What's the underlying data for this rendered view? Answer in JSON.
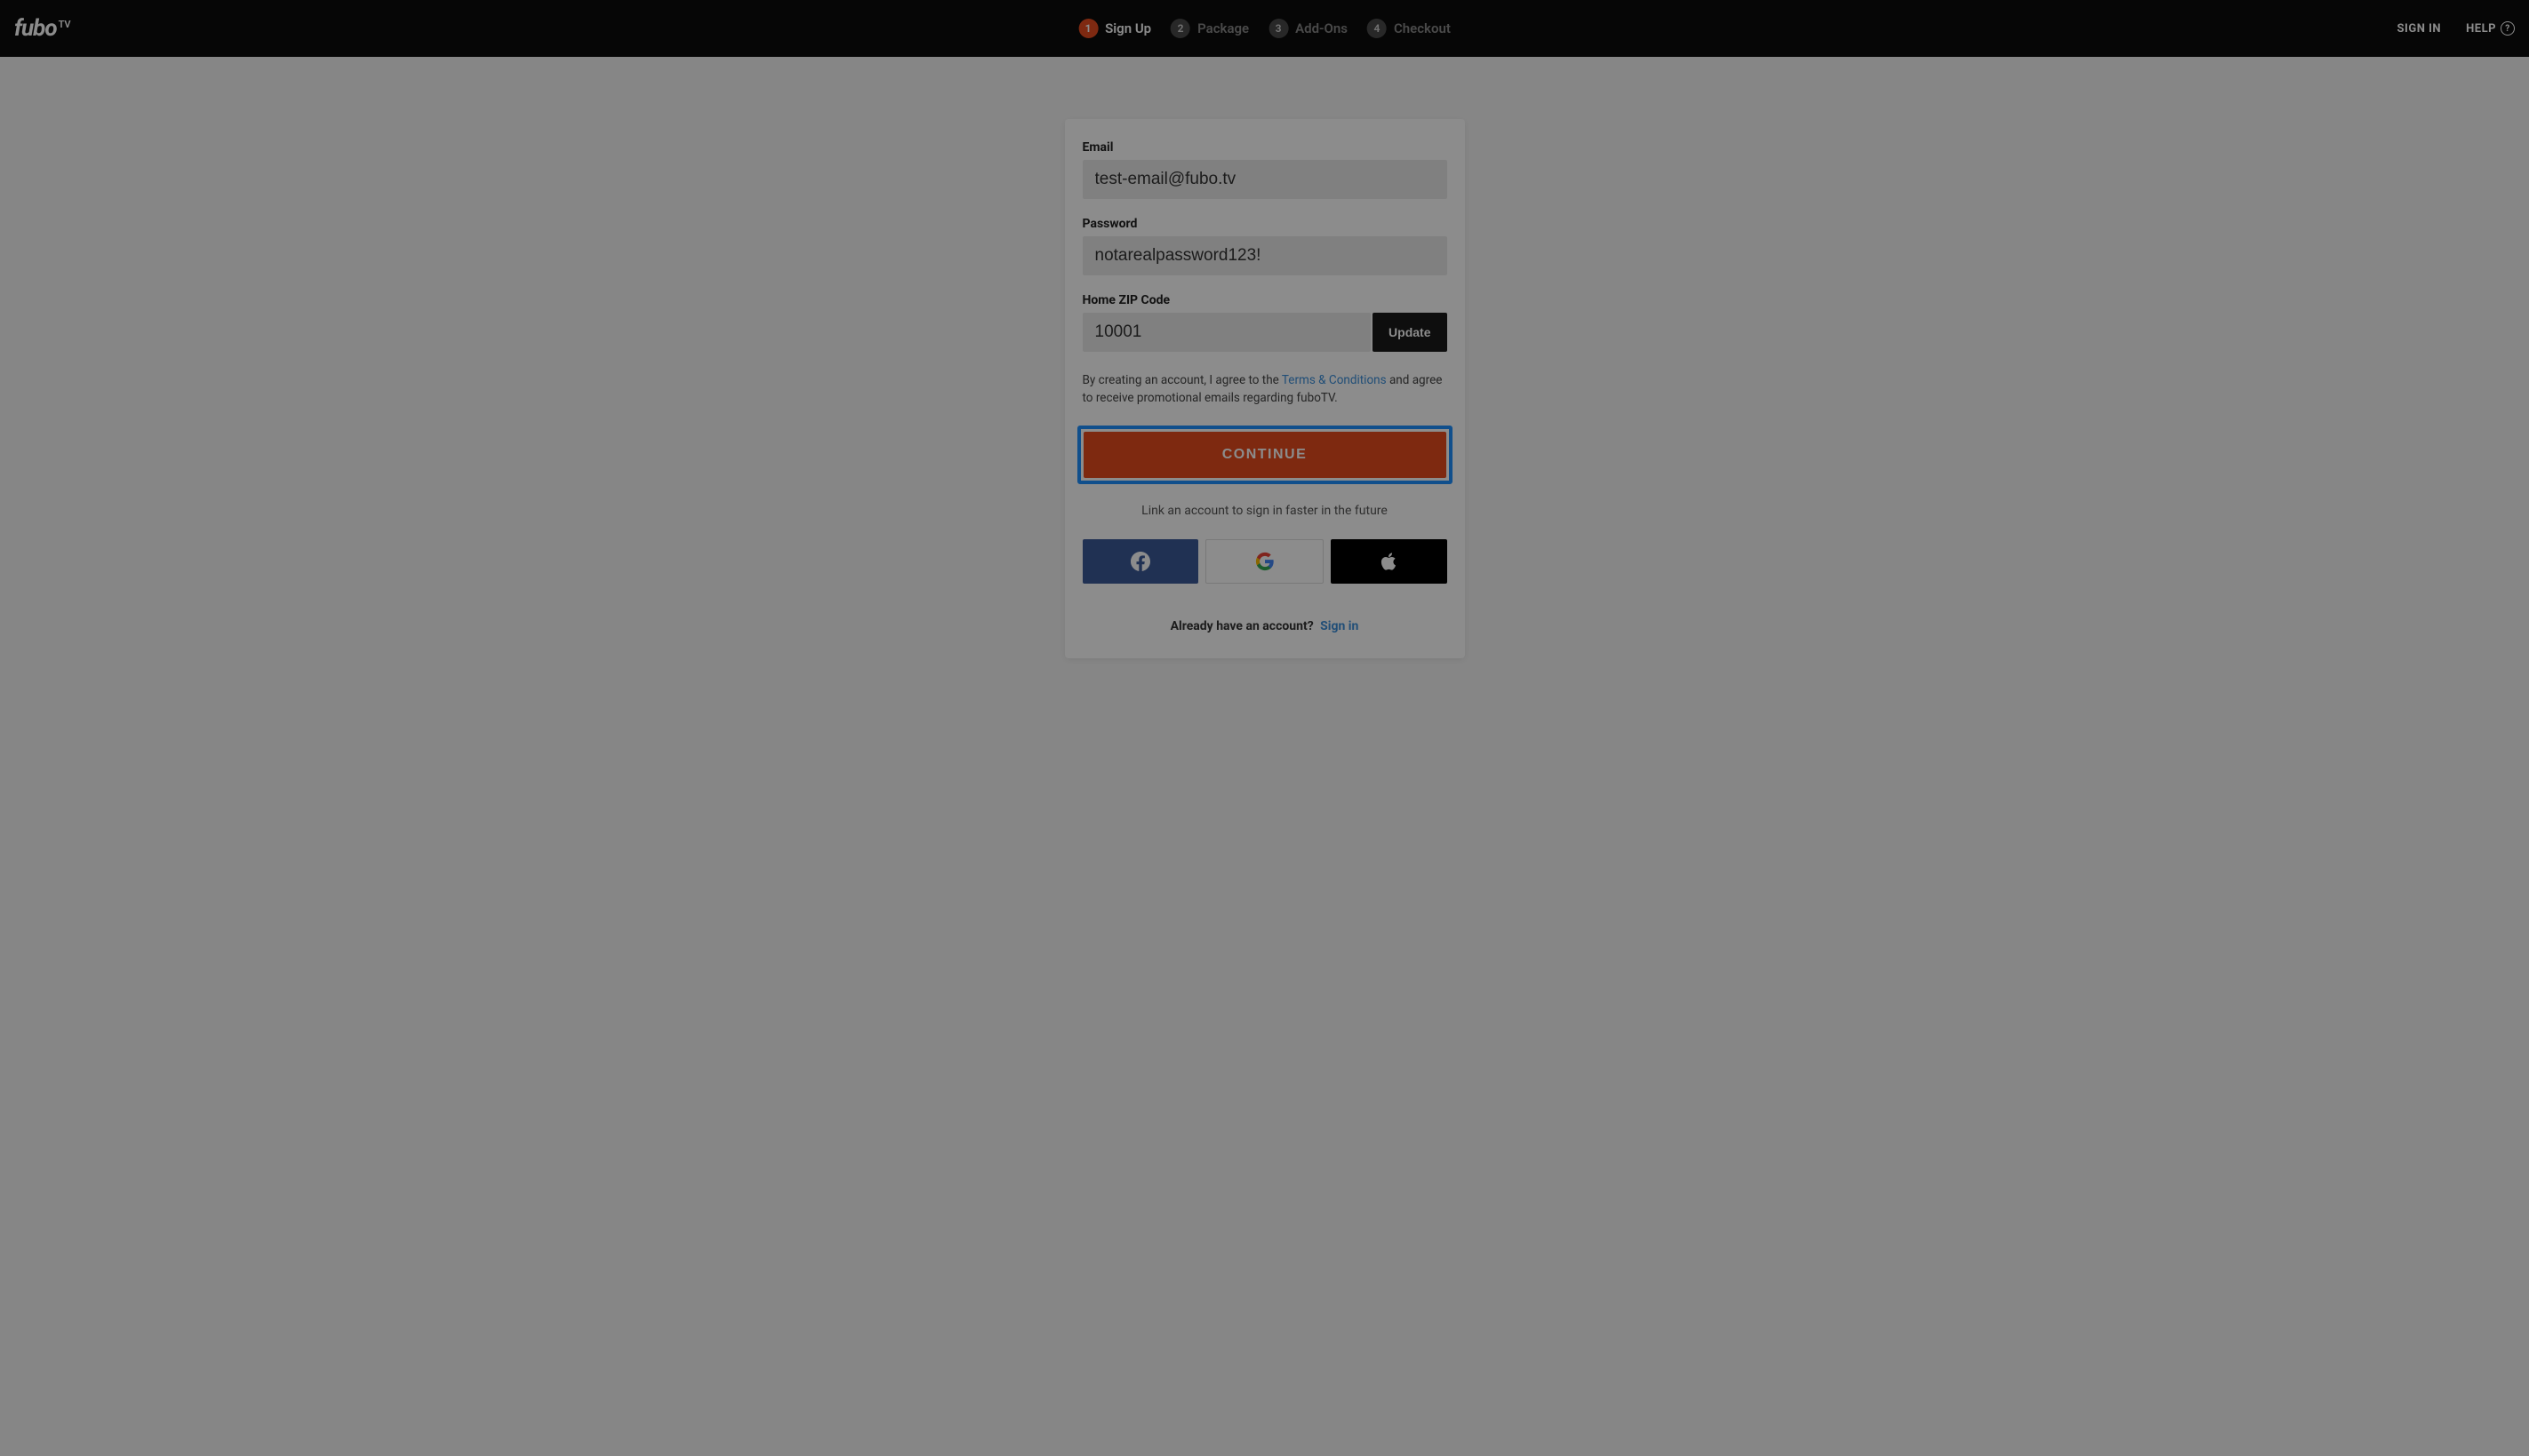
{
  "header": {
    "logo_main": "fubo",
    "logo_sup": "TV",
    "steps": [
      {
        "num": "1",
        "label": "Sign Up",
        "active": true
      },
      {
        "num": "2",
        "label": "Package",
        "active": false
      },
      {
        "num": "3",
        "label": "Add-Ons",
        "active": false
      },
      {
        "num": "4",
        "label": "Checkout",
        "active": false
      }
    ],
    "sign_in": "SIGN IN",
    "help": "HELP",
    "help_q": "?"
  },
  "form": {
    "email_label": "Email",
    "email_value": "test-email@fubo.tv",
    "password_label": "Password",
    "password_value": "notarealpassword123!",
    "zip_label": "Home ZIP Code",
    "zip_value": "10001",
    "update_label": "Update",
    "terms_pre": "By creating an account, I agree to the ",
    "terms_link": "Terms & Conditions",
    "terms_post": " and agree to receive promotional emails regarding fuboTV.",
    "continue_label": "CONTINUE",
    "link_text": "Link an account to sign in faster in the future",
    "already_text": "Already have an account?",
    "already_signin": "Sign in"
  }
}
